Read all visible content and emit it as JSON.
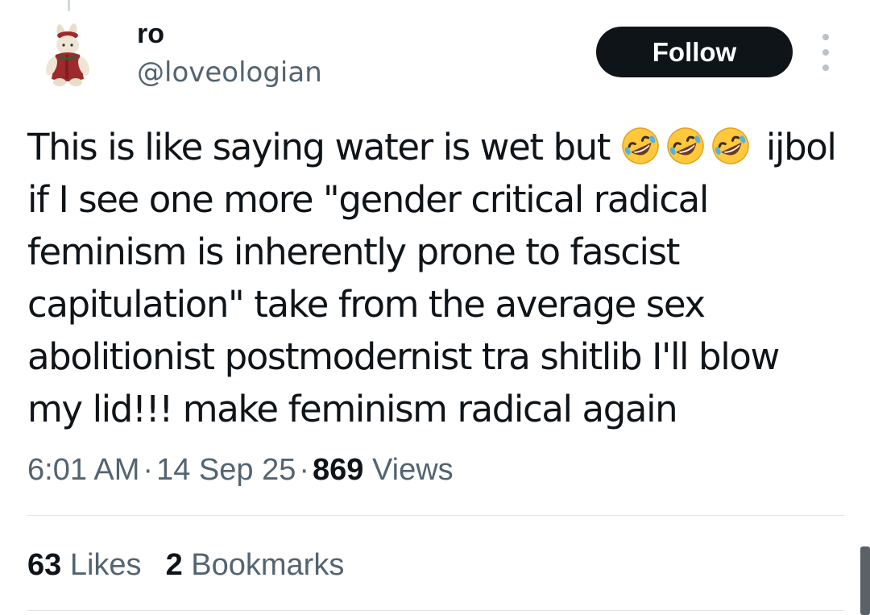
{
  "author": {
    "display_name": "ro",
    "handle": "@loveologian",
    "avatar_icon": "plush-bunny-avatar-icon"
  },
  "actions": {
    "follow_label": "Follow",
    "more_icon": "more-options-icon"
  },
  "tweet": {
    "text_part1": "This is like saying water is wet but",
    "emoji_name": "rolling-on-floor-laughing-emoji",
    "text_part2": "ijbol if I see one more \"gender critical radical feminism is inherently prone to fascist capitulation\" take from the average sex abolitionist postmodernist tra shitlib I'll blow my lid!!! make feminism radical again"
  },
  "meta": {
    "time": "6:01 AM",
    "separator": "·",
    "date": "14 Sep 25",
    "views_count": "869",
    "views_label": "Views"
  },
  "stats": {
    "likes_count": "63",
    "likes_label": "Likes",
    "bookmarks_count": "2",
    "bookmarks_label": "Bookmarks"
  },
  "colors": {
    "text_primary": "#0f1419",
    "text_secondary": "#536471",
    "follow_bg": "#0f1419",
    "divider": "#e1e6ea",
    "emoji_face": "#ffc83d"
  }
}
